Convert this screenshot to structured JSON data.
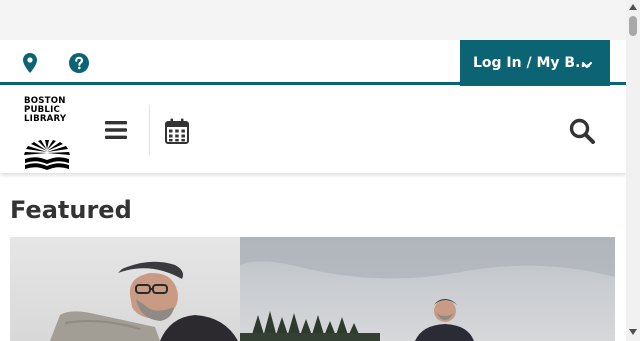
{
  "utility_bar": {
    "location_icon": "map-pin-icon",
    "help_icon": "question-circle-icon",
    "login_label": "Log In / My B...",
    "accent_color": "#0c6374"
  },
  "header": {
    "logo_lines": [
      "BOSTON",
      "PUBLIC",
      "LIBRARY"
    ],
    "menu_icon": "hamburger-menu-icon",
    "calendar_icon": "calendar-icon",
    "search_icon": "search-icon"
  },
  "main": {
    "section_title": "Featured"
  }
}
